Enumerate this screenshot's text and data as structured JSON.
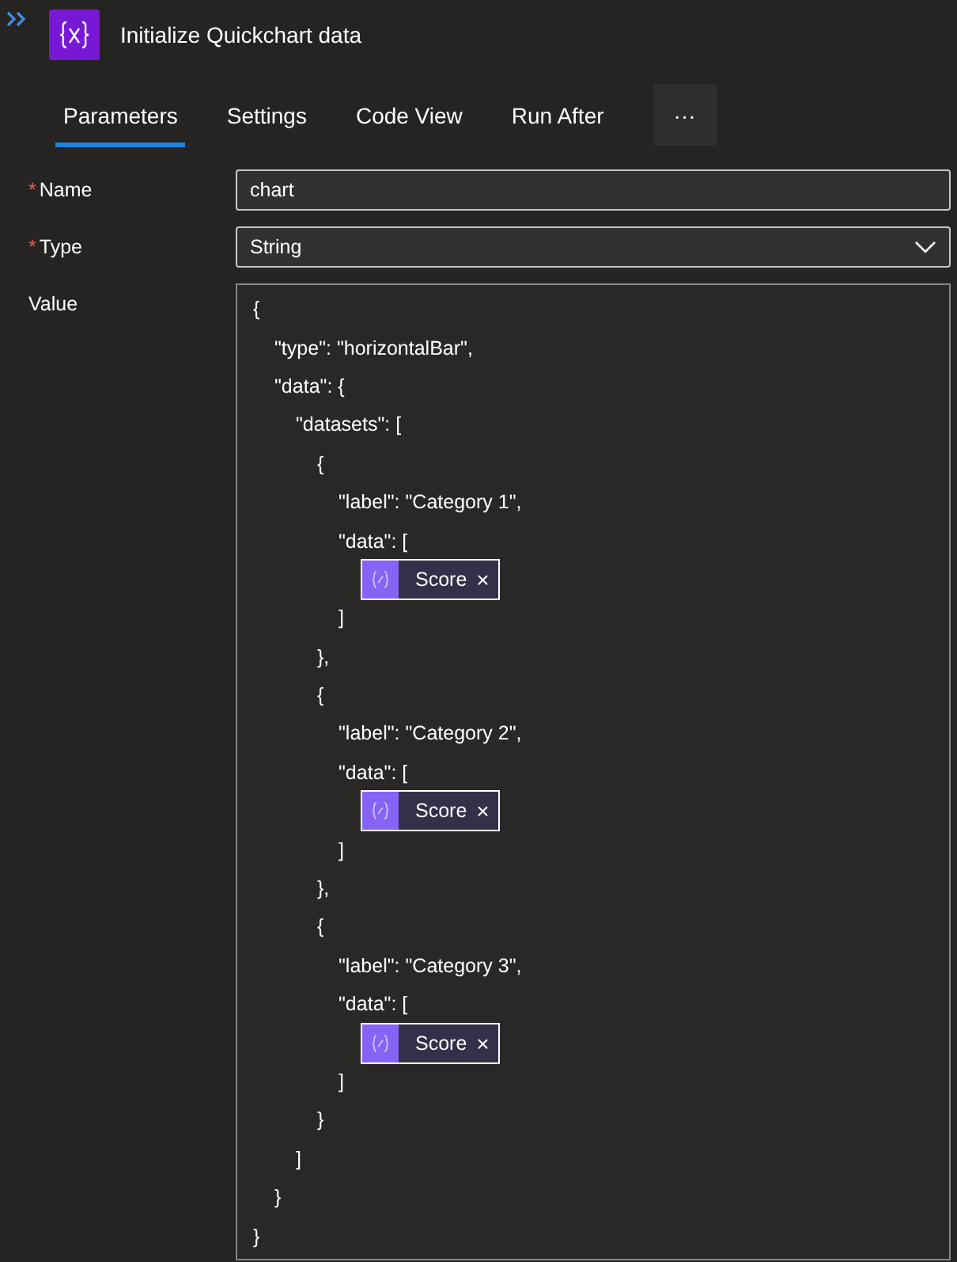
{
  "header": {
    "title": "Initialize Quickchart data"
  },
  "tabs": [
    {
      "label": "Parameters",
      "selected": true
    },
    {
      "label": "Settings",
      "selected": false
    },
    {
      "label": "Code View",
      "selected": false
    },
    {
      "label": "Run After",
      "selected": false
    }
  ],
  "more_button": {
    "label": "···"
  },
  "fields": [
    {
      "kind": "text",
      "required_mark": "*",
      "label": "Name",
      "value": "chart"
    },
    {
      "kind": "dropdown",
      "required_mark": "*",
      "label": "Type",
      "value": "String"
    }
  ],
  "value_editor": {
    "label": "Value",
    "lines": [
      {
        "kind": "text",
        "text": "{",
        "children": [
          {
            "kind": "text",
            "text": "\"type\": \"horizontalBar\","
          },
          {
            "kind": "text",
            "text": "\"data\": {",
            "children": [
              {
                "kind": "text",
                "text": "\"datasets\": [",
                "children": [
                  {
                    "kind": "text",
                    "text": "{",
                    "children": [
                      {
                        "kind": "text",
                        "text": "\"label\": \"Category 1\","
                      },
                      {
                        "kind": "text",
                        "text": "\"data\": [",
                        "children": [
                          {
                            "kind": "token",
                            "text": "Score",
                            "remove": "×"
                          }
                        ]
                      },
                      {
                        "kind": "text",
                        "text": "]"
                      }
                    ]
                  },
                  {
                    "kind": "text",
                    "text": "},"
                  },
                  {
                    "kind": "text",
                    "text": "{",
                    "children": [
                      {
                        "kind": "text",
                        "text": "\"label\": \"Category 2\","
                      },
                      {
                        "kind": "text",
                        "text": "\"data\": [",
                        "children": [
                          {
                            "kind": "token",
                            "text": "Score",
                            "remove": "×"
                          }
                        ]
                      },
                      {
                        "kind": "text",
                        "text": "]"
                      }
                    ]
                  },
                  {
                    "kind": "text",
                    "text": "},"
                  },
                  {
                    "kind": "text",
                    "text": "{",
                    "children": [
                      {
                        "kind": "text",
                        "text": "\"label\": \"Category 3\","
                      },
                      {
                        "kind": "text",
                        "text": "\"data\": [",
                        "children": [
                          {
                            "kind": "token",
                            "text": "Score",
                            "remove": "×"
                          }
                        ]
                      },
                      {
                        "kind": "text",
                        "text": "]"
                      }
                    ]
                  },
                  {
                    "kind": "text",
                    "text": "}"
                  }
                ]
              },
              {
                "kind": "text",
                "text": "]"
              }
            ]
          },
          {
            "kind": "text",
            "text": "}"
          }
        ]
      },
      {
        "kind": "text",
        "text": "}"
      }
    ]
  }
}
